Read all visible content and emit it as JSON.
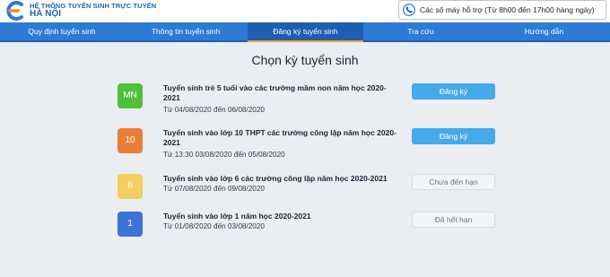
{
  "brand": {
    "top_line": "HỆ THỐNG TUYỂN SINH TRỰC TUYẾN",
    "city": "HÀ NỘI",
    "accent_color": "#1f62b8"
  },
  "support": {
    "text": "Các số máy hỗ trợ (Từ 8h00 đến 17h00 hàng ngày)",
    "icon": "phone-icon"
  },
  "nav": {
    "items": [
      {
        "label": "Quy định tuyển sinh"
      },
      {
        "label": "Thông tin tuyển sinh"
      },
      {
        "label": "Đăng ký tuyển sinh",
        "active": true
      },
      {
        "label": "Tra cứu"
      },
      {
        "label": "Hướng dẫn"
      }
    ],
    "colors": {
      "bar": "#2d7bd4",
      "active": "#1d5fb0",
      "underline": "#f2a13a"
    }
  },
  "page": {
    "title": "Chọn kỳ tuyển sinh"
  },
  "enrollments": [
    {
      "badge": "MN",
      "badge_color": "#4fc03a",
      "title": "Tuyển sinh trẻ 5 tuổi vào các trường mầm non năm học 2020-2021",
      "date": "Từ 04/08/2020 đến 06/08/2020",
      "button": "Đăng ký",
      "button_state": "enabled"
    },
    {
      "badge": "10",
      "badge_color": "#ea7e39",
      "title": "Tuyển sinh vào lớp 10 THPT các trường công lập năm học 2020-2021",
      "date": "Từ 13:30 03/08/2020 đến 05/08/2020",
      "button": "Đăng ký",
      "button_state": "enabled"
    },
    {
      "badge": "6",
      "badge_color": "#f2cf5e",
      "title": "Tuyển sinh vào lớp 6 các trường công lập năm học 2020-2021",
      "date": "Từ 07/08/2020 đến 09/08/2020",
      "button": "Chưa đến hạn",
      "button_state": "disabled"
    },
    {
      "badge": "1",
      "badge_color": "#3d72d8",
      "title": "Tuyển sinh vào lớp 1 năm học 2020-2021",
      "date": "Từ 01/08/2020 đến 03/08/2020",
      "button": "Đã hết hạn",
      "button_state": "disabled"
    }
  ]
}
